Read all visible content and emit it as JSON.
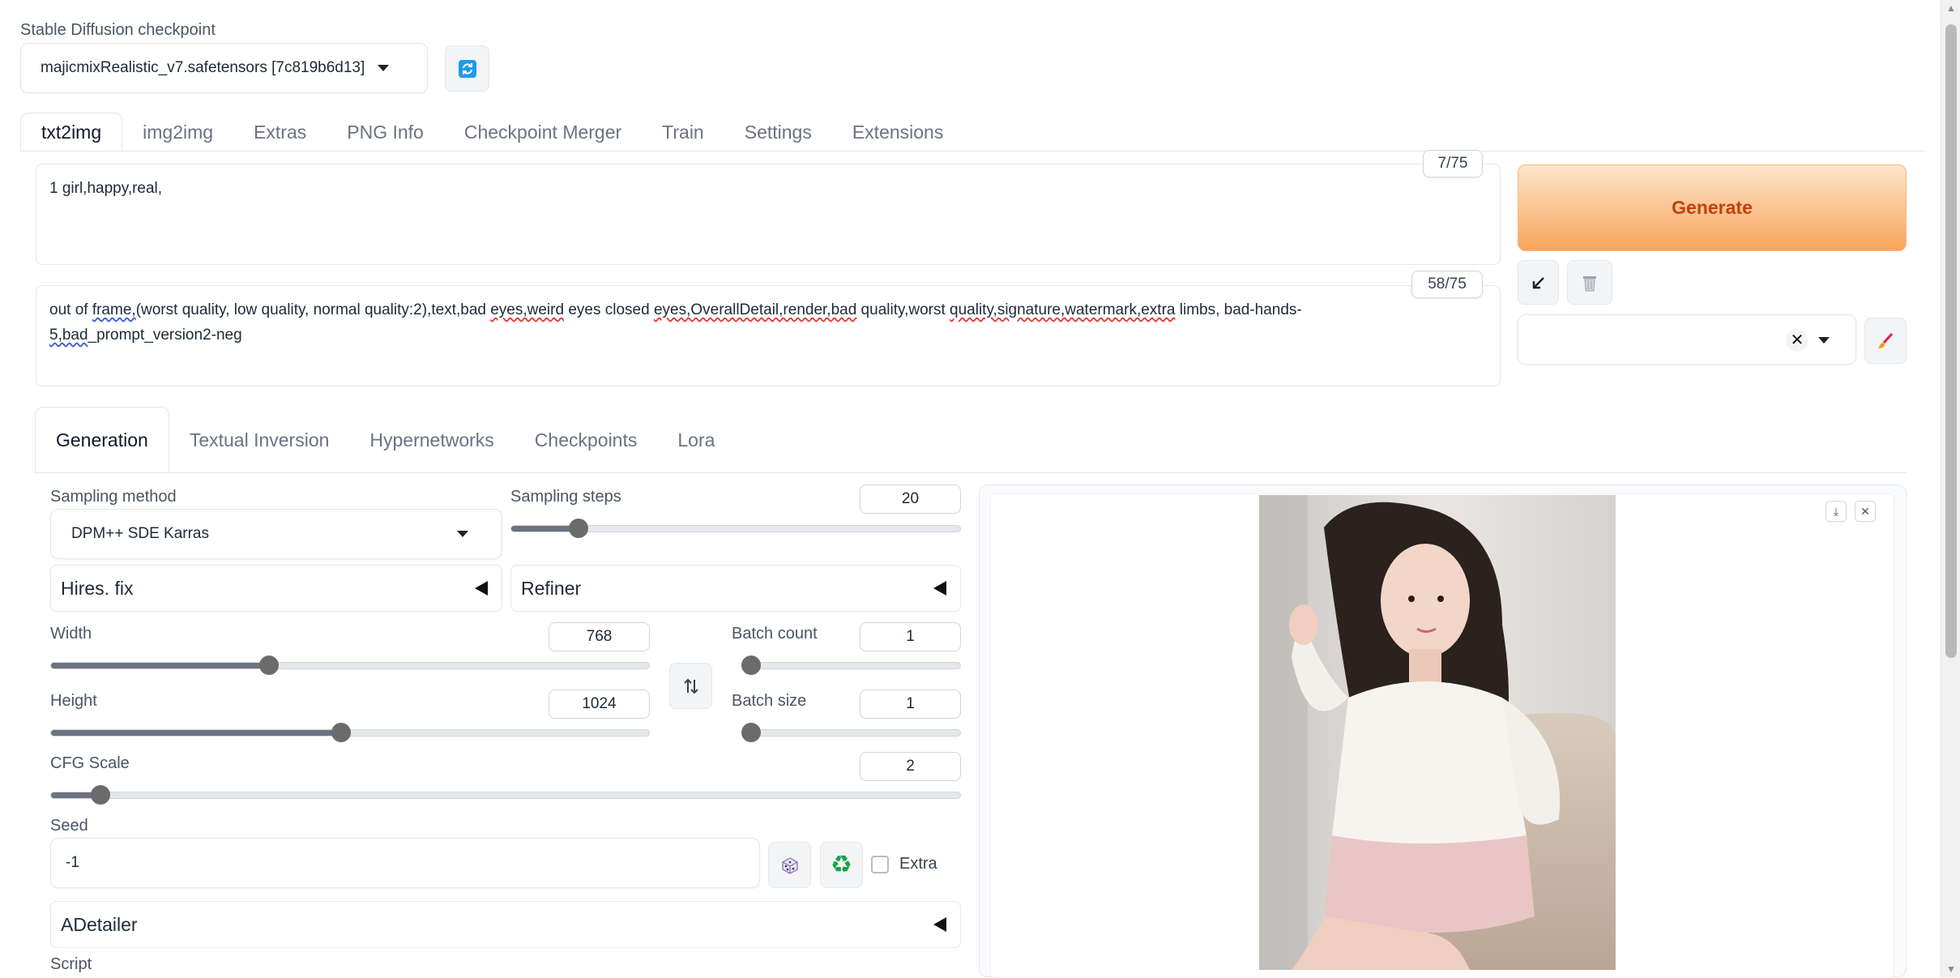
{
  "checkpoint": {
    "label": "Stable Diffusion checkpoint",
    "selected": "majicmixRealistic_v7.safetensors [7c819b6d13]"
  },
  "main_tabs": [
    {
      "label": "txt2img",
      "active": true
    },
    {
      "label": "img2img"
    },
    {
      "label": "Extras"
    },
    {
      "label": "PNG Info"
    },
    {
      "label": "Checkpoint Merger"
    },
    {
      "label": "Train"
    },
    {
      "label": "Settings"
    },
    {
      "label": "Extensions"
    }
  ],
  "prompt": {
    "text": "1 girl,happy,real,",
    "token_count": "7/75"
  },
  "negative_prompt": {
    "parts": {
      "p1": "out of ",
      "p2": "frame,",
      "p3": "(worst quality, low quality, normal quality:2),text,bad ",
      "p4": "eyes,weird",
      "p5": " eyes closed ",
      "p6": "eyes,OverallDetail,render,bad",
      "p7": " quality,worst ",
      "p8": "quality,signature,watermark,extra",
      "p9": " limbs, bad-hands-",
      "p10": "5,bad",
      "p11": "_prompt_version2-neg"
    },
    "token_count": "58/75"
  },
  "generate_label": "Generate",
  "sub_tabs": [
    {
      "label": "Generation",
      "active": true
    },
    {
      "label": "Textual Inversion"
    },
    {
      "label": "Hypernetworks"
    },
    {
      "label": "Checkpoints"
    },
    {
      "label": "Lora"
    }
  ],
  "generation": {
    "sampling_method_label": "Sampling method",
    "sampling_method_value": "DPM++ SDE Karras",
    "sampling_steps_label": "Sampling steps",
    "sampling_steps_value": "20",
    "hires_fix_label": "Hires. fix",
    "refiner_label": "Refiner",
    "width_label": "Width",
    "width_value": "768",
    "height_label": "Height",
    "height_value": "1024",
    "batch_count_label": "Batch count",
    "batch_count_value": "1",
    "batch_size_label": "Batch size",
    "batch_size_value": "1",
    "cfg_label": "CFG Scale",
    "cfg_value": "2",
    "seed_label": "Seed",
    "seed_value": "-1",
    "extra_label": "Extra",
    "adetailer_label": "ADetailer",
    "script_label": "Script"
  },
  "sliders": {
    "sampling_steps": 0.135,
    "width": 0.36,
    "height": 0.485,
    "batch_count": 0.0,
    "batch_size": 0.0,
    "cfg_scale": 0.045
  },
  "icons": {
    "refresh": "refresh-icon",
    "swap": "swap-dimensions-icon",
    "dice": "dice-icon",
    "recycle": "recycle-icon",
    "arrow": "read-params-icon",
    "trash": "trash-icon",
    "brush": "brush-icon",
    "download": "download-icon",
    "close": "close-icon"
  },
  "colors": {
    "generate_top": "#fde5cc",
    "generate_bottom": "#f9a55a",
    "generate_text": "#c2410c",
    "refresh_blue": "#1e9be9",
    "recycle_green": "#16a34a"
  }
}
